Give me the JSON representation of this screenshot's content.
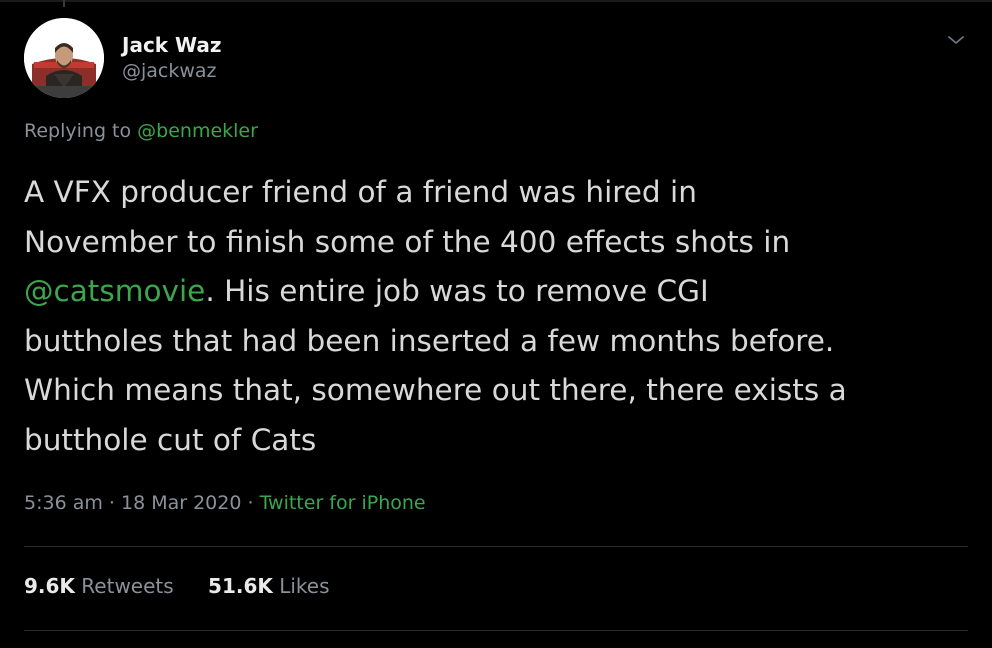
{
  "author": {
    "display_name": "Jack Waz",
    "handle": "@jackwaz",
    "avatar_icon": "profile-photo",
    "menu_icon": "chevron-down-icon"
  },
  "reply": {
    "prefix": "Replying to ",
    "mention": "@benmekler"
  },
  "tweet": {
    "line1": "A VFX producer friend of a friend was hired in",
    "line2": "November to finish some of the 400 effects shots in",
    "line3_mention": "@catsmovie",
    "line3_rest": ". His entire job was to remove CGI",
    "line4": "buttholes that had been inserted a few months before.",
    "line5": "Which means that, somewhere out there, there exists a",
    "line6": "butthole cut of Cats"
  },
  "meta": {
    "time": "5:36 am",
    "separator": " · ",
    "date": "18 Mar 2020",
    "source": "Twitter for iPhone"
  },
  "stats": {
    "retweets_count": "9.6K",
    "retweets_label": " Retweets",
    "likes_count": "51.6K",
    "likes_label": " Likes"
  },
  "colors": {
    "background": "#000000",
    "text": "#d9d9d9",
    "muted": "#8a9199",
    "link": "#3ca64d"
  }
}
